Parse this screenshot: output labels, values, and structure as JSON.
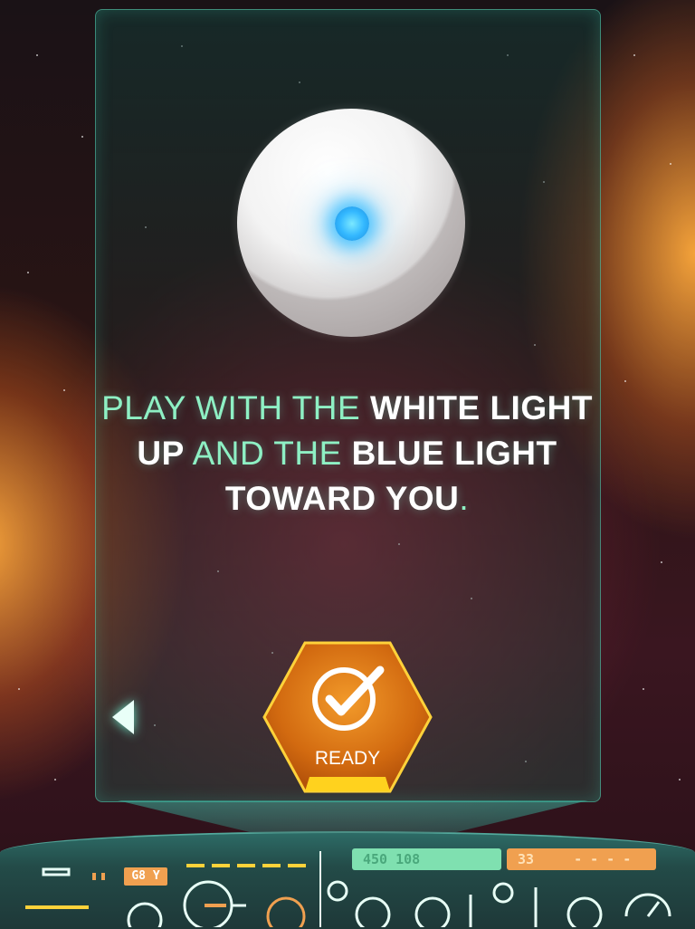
{
  "instruction": {
    "part1": "PLAY WITH THE ",
    "part2": "WHITE LIGHT",
    "part3": "UP",
    "part4": " AND THE ",
    "part5": "BLUE LIGHT",
    "part6": "TOWARD YOU",
    "part7": "."
  },
  "ready_button": {
    "label": "READY",
    "icon": "checkmark-icon"
  },
  "back_button": {
    "icon": "left-arrow-icon"
  },
  "hud": {
    "green_readout": "450  108",
    "orange_readout": "33",
    "orange_readout_suffix": "- - - -",
    "badge": "G8 Y"
  },
  "colors": {
    "accent_green": "#8ef0c4",
    "panel_border": "#5adcbe",
    "ready_orange": "#e07a10",
    "blue_light": "#34b8ff"
  }
}
